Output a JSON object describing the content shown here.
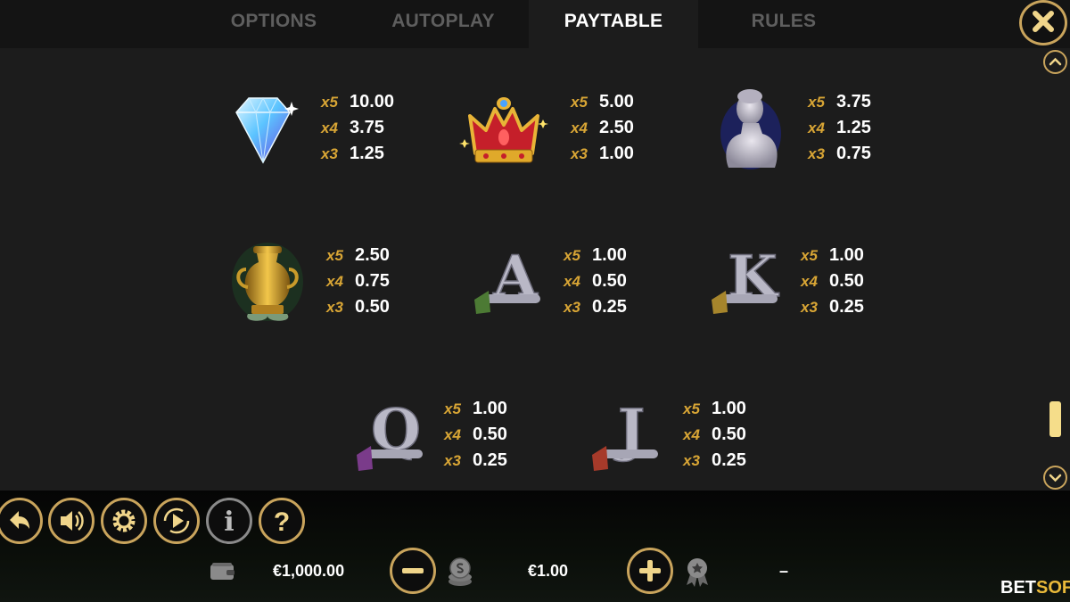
{
  "tabs": {
    "options": "OPTIONS",
    "autoplay": "AUTOPLAY",
    "paytable": "PAYTABLE",
    "rules": "RULES"
  },
  "paytable": {
    "symbols": [
      {
        "name": "diamond",
        "pays": [
          {
            "mult": "x5",
            "value": "10.00"
          },
          {
            "mult": "x4",
            "value": "3.75"
          },
          {
            "mult": "x3",
            "value": "1.25"
          }
        ]
      },
      {
        "name": "crown",
        "pays": [
          {
            "mult": "x5",
            "value": "5.00"
          },
          {
            "mult": "x4",
            "value": "2.50"
          },
          {
            "mult": "x3",
            "value": "1.00"
          }
        ]
      },
      {
        "name": "statue",
        "pays": [
          {
            "mult": "x5",
            "value": "3.75"
          },
          {
            "mult": "x4",
            "value": "1.25"
          },
          {
            "mult": "x3",
            "value": "0.75"
          }
        ]
      },
      {
        "name": "vase",
        "pays": [
          {
            "mult": "x5",
            "value": "2.50"
          },
          {
            "mult": "x4",
            "value": "0.75"
          },
          {
            "mult": "x3",
            "value": "0.50"
          }
        ]
      },
      {
        "name": "letter-a",
        "pays": [
          {
            "mult": "x5",
            "value": "1.00"
          },
          {
            "mult": "x4",
            "value": "0.50"
          },
          {
            "mult": "x3",
            "value": "0.25"
          }
        ]
      },
      {
        "name": "letter-k",
        "pays": [
          {
            "mult": "x5",
            "value": "1.00"
          },
          {
            "mult": "x4",
            "value": "0.50"
          },
          {
            "mult": "x3",
            "value": "0.25"
          }
        ]
      },
      {
        "name": "letter-q",
        "pays": [
          {
            "mult": "x5",
            "value": "1.00"
          },
          {
            "mult": "x4",
            "value": "0.50"
          },
          {
            "mult": "x3",
            "value": "0.25"
          }
        ]
      },
      {
        "name": "letter-j",
        "pays": [
          {
            "mult": "x5",
            "value": "1.00"
          },
          {
            "mult": "x4",
            "value": "0.50"
          },
          {
            "mult": "x3",
            "value": "0.25"
          }
        ]
      }
    ]
  },
  "symbol_letters": {
    "a": "A",
    "k": "K",
    "q": "Q",
    "j": "J"
  },
  "bottom": {
    "balance": "€1,000.00",
    "bet": "€1.00",
    "win": "–",
    "info_glyph": "i",
    "help_glyph": "?"
  },
  "logo": {
    "bet": "BET",
    "soft": "SOFT"
  },
  "colors": {
    "accent_gold": "#c9a45c",
    "multiplier_gold": "#d8a535",
    "panel": "#1c1c1c",
    "tab_inactive": "#5e5e5e"
  },
  "icons": [
    "close-icon",
    "chevron-up-icon",
    "chevron-down-icon",
    "back-arrow-icon",
    "speaker-icon",
    "gear-icon",
    "autoplay-icon",
    "info-icon",
    "help-icon",
    "wallet-icon",
    "minus-icon",
    "coins-icon",
    "plus-icon",
    "award-icon"
  ]
}
